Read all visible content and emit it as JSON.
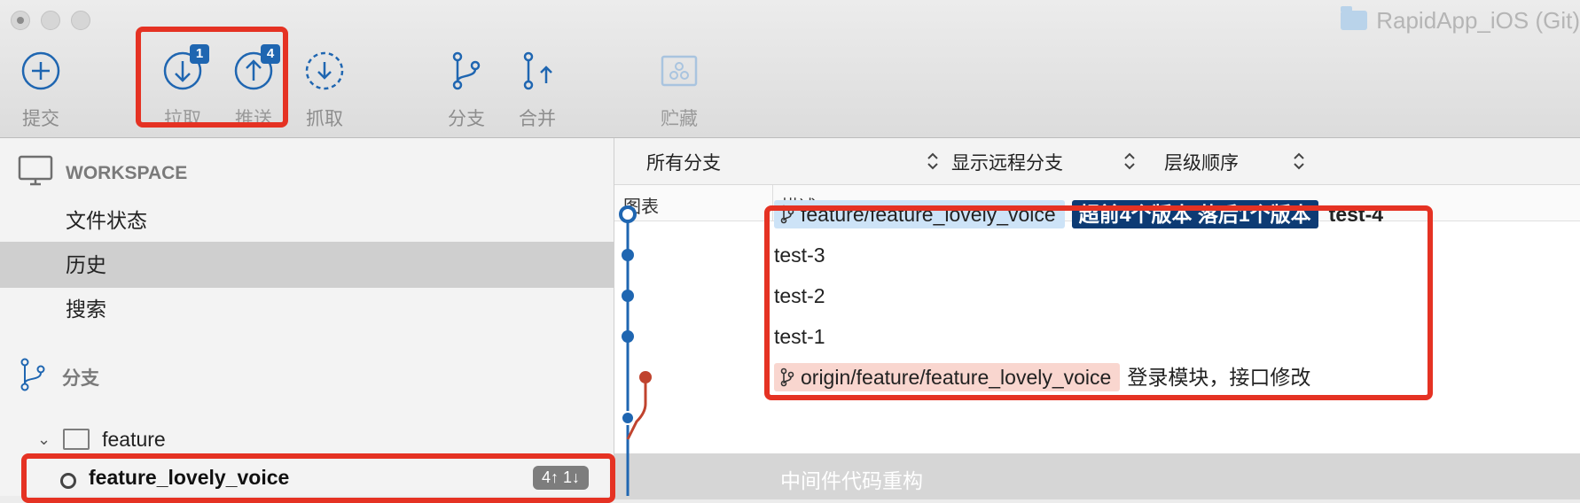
{
  "window": {
    "title": "RapidApp_iOS (Git)"
  },
  "toolbar": {
    "commit_label": "提交",
    "pull_label": "拉取",
    "pull_badge": "1",
    "push_label": "推送",
    "push_badge": "4",
    "fetch_label": "抓取",
    "branch_label": "分支",
    "merge_label": "合并",
    "stash_label": "贮藏"
  },
  "sidebar": {
    "workspace_label": "WORKSPACE",
    "items": [
      {
        "label": "文件状态",
        "selected": false
      },
      {
        "label": "历史",
        "selected": true
      },
      {
        "label": "搜索",
        "selected": false
      }
    ],
    "branches_label": "分支",
    "folder_label": "feature",
    "branch_row": {
      "name": "feature_lovely_voice",
      "counts": "4↑ 1↓"
    }
  },
  "filters": {
    "branches": "所有分支",
    "remote": "显示远程分支",
    "order": "层级顺序"
  },
  "columns": {
    "graph": "图表",
    "description": "描述"
  },
  "commits": [
    {
      "branch_tag": "feature/feature_lovely_voice",
      "status_tag": "超前4个版本 落后1个版本",
      "message": "test-4"
    },
    {
      "message": "test-3"
    },
    {
      "message": "test-2"
    },
    {
      "message": "test-1"
    },
    {
      "remote_tag": "origin/feature/feature_lovely_voice",
      "message": "登录模块，接口修改"
    },
    {
      "message": "中间件代码重构"
    }
  ],
  "colors": {
    "accent": "#1f66b1",
    "highlight_box": "#e53223",
    "remote_line": "#c0432e",
    "status_tag": "#0d3b74"
  }
}
